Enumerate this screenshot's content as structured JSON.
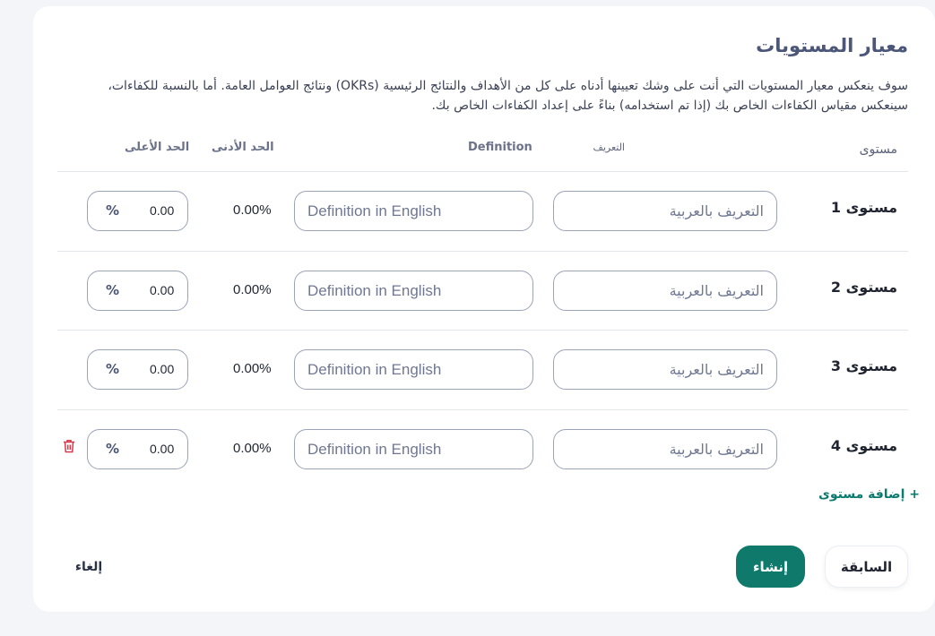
{
  "title": "معيار المستويات",
  "description": "سوف ينعكس معيار المستويات التي أنت على وشك تعيينها أدناه على كل من الأهداف والنتائج الرئيسية (OKRs) ونتائج العوامل العامة. أما بالنسبة للكفاءات، سينعكس مقياس الكفاءات الخاص بك (إذا تم استخدامه) بناءً على إعداد الكفاءات الخاص بك.",
  "headers": {
    "level": "مستوى",
    "definition_ar": "التعريف",
    "definition_en": "Definition",
    "min": "الحد الأدنى",
    "max": "الحد الأعلى"
  },
  "rows": [
    {
      "label": "مستوى 1",
      "ar_placeholder": "التعريف بالعربية",
      "en_placeholder": "Definition in English",
      "min": "0.00%",
      "max": "0.00",
      "unit": "%"
    },
    {
      "label": "مستوى 2",
      "ar_placeholder": "التعريف بالعربية",
      "en_placeholder": "Definition in English",
      "min": "0.00%",
      "max": "0.00",
      "unit": "%"
    },
    {
      "label": "مستوى 3",
      "ar_placeholder": "التعريف بالعربية",
      "en_placeholder": "Definition in English",
      "min": "0.00%",
      "max": "0.00",
      "unit": "%"
    },
    {
      "label": "مستوى 4",
      "ar_placeholder": "التعريف بالعربية",
      "en_placeholder": "Definition in English",
      "min": "0.00%",
      "max": "0.00",
      "unit": "%",
      "deletable": true
    }
  ],
  "add_level": "+ إضافة مستوى",
  "buttons": {
    "previous": "السابقة",
    "create": "إنشاء",
    "cancel": "إلغاء"
  },
  "colors": {
    "primary": "#0f7a6c",
    "danger": "#d63a4a",
    "title": "#4b5678"
  },
  "icons": {
    "delete": "trash-icon"
  }
}
